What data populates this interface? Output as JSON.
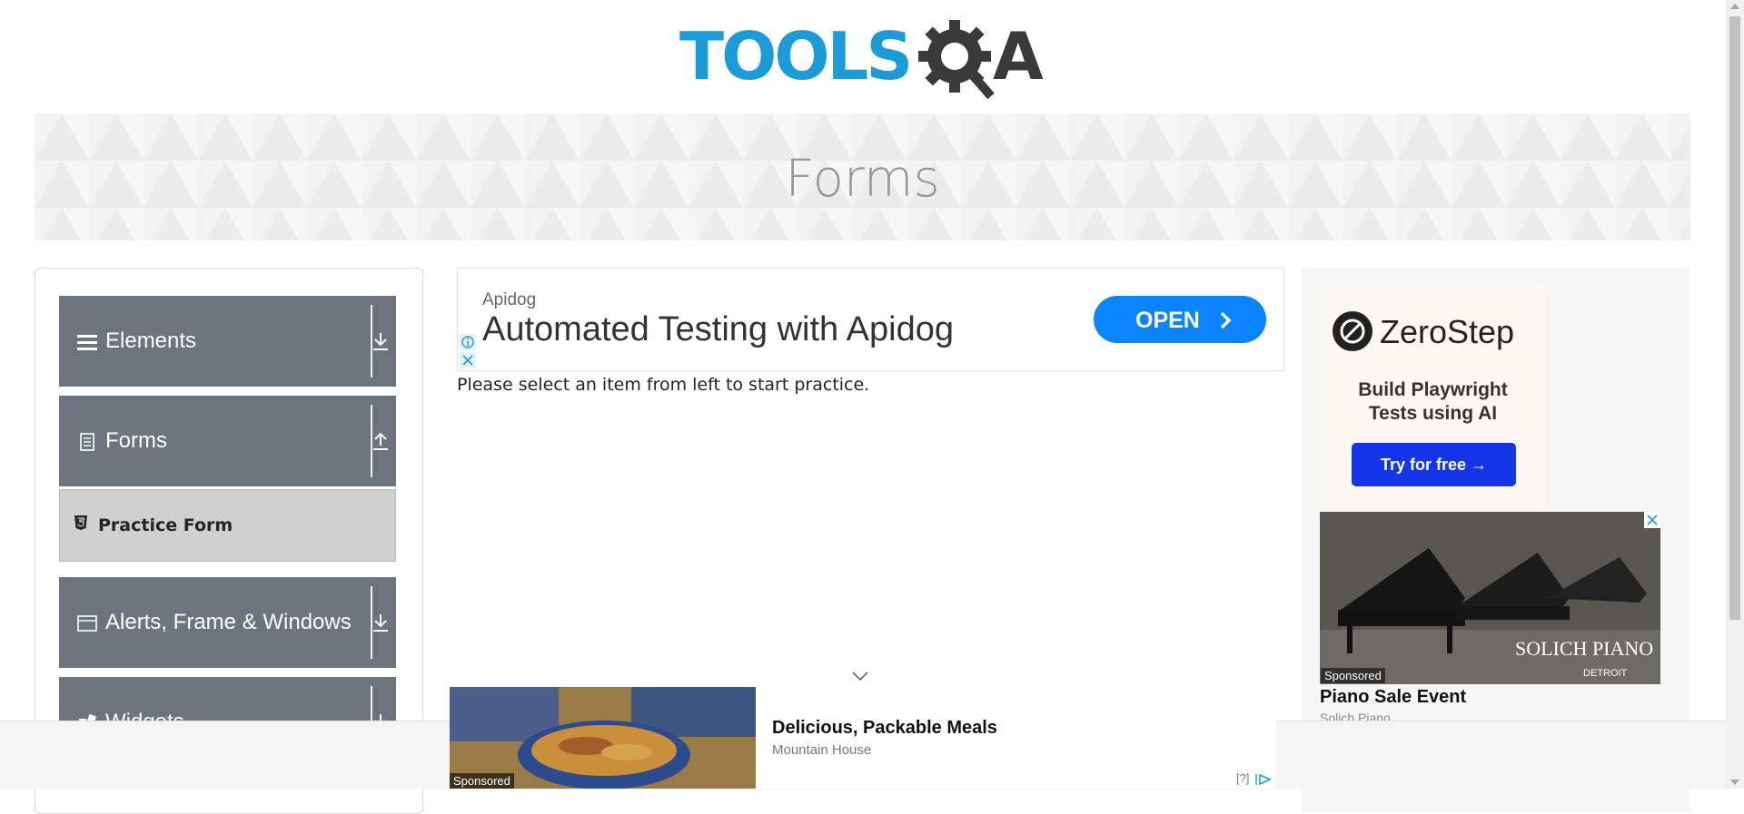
{
  "header": {
    "logo_text": "TOOLSQA"
  },
  "banner": {
    "title": "Forms"
  },
  "sidebar": {
    "groups": [
      {
        "label": "Elements",
        "icon": "hamburger-icon",
        "toggle": "download-icon"
      },
      {
        "label": "Forms",
        "icon": "document-icon",
        "toggle": "upload-icon"
      },
      {
        "label": "Alerts, Frame & Windows",
        "icon": "window-icon",
        "toggle": "download-icon"
      },
      {
        "label": "Widgets",
        "icon": "widgets-icon",
        "toggle": "download-icon"
      }
    ],
    "forms_items": [
      {
        "label": "Practice Form",
        "icon": "html5-icon"
      }
    ]
  },
  "center_ad": {
    "brand": "Apidog",
    "headline": "Automated Testing with Apidog",
    "cta": "OPEN"
  },
  "main": {
    "instruction": "Please select an item from left to start practice."
  },
  "right_ads": {
    "zerostep": {
      "name": "ZeroStep",
      "tagline_line1": "Build Playwright",
      "tagline_line2": "Tests using AI",
      "cta": "Try for free →"
    },
    "piano": {
      "sponsored": "Sponsored",
      "brand": "SOLICH PIANO",
      "brand_sub": "DETROIT",
      "title": "Piano Sale Event",
      "advertiser": "Solich Piano"
    }
  },
  "sticky_ad": {
    "sponsored": "Sponsored",
    "title": "Delicious, Packable Meals",
    "advertiser": "Mountain House",
    "help": "[?]"
  },
  "colors": {
    "logo_blue": "#1b9bd7",
    "logo_dark": "#3a3a3a",
    "sidebar_header": "#6c757d",
    "submenu_active": "#d0d0d0",
    "cta_blue": "#0a84ff",
    "zerostep_blue": "#1435e8"
  }
}
